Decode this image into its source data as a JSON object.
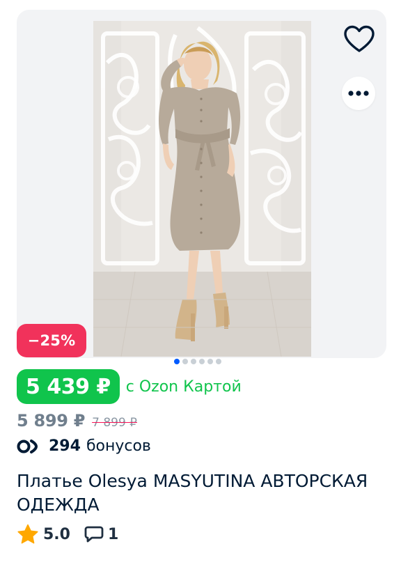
{
  "product": {
    "discount": "−25%",
    "price": "5 439 ₽",
    "price_note": "с Ozon Картой",
    "old_price": "5 899 ₽",
    "strikethrough_price": "7 899 ₽",
    "bonus_count": "294",
    "bonus_label": "бонусов",
    "title": "Платье Olesya MASYUTINA АВТОРСКАЯ ОДЕЖДА",
    "rating": "5.0",
    "reviews": "1"
  },
  "gallery": {
    "image_count": 6,
    "active_index": 0
  },
  "icons": {
    "favorite": "heart-outline-icon",
    "more": "more-dots-icon",
    "bonus": "ozon-bonus-icon",
    "rating": "star-icon",
    "reviews": "speech-bubble-icon"
  },
  "colors": {
    "discount_bg": "#f1325b",
    "price_bg": "#10c44c",
    "card_text": "#10c44c",
    "active_dot": "#005bff",
    "inactive_dot": "#c9d0d6",
    "star": "#ffa800"
  }
}
